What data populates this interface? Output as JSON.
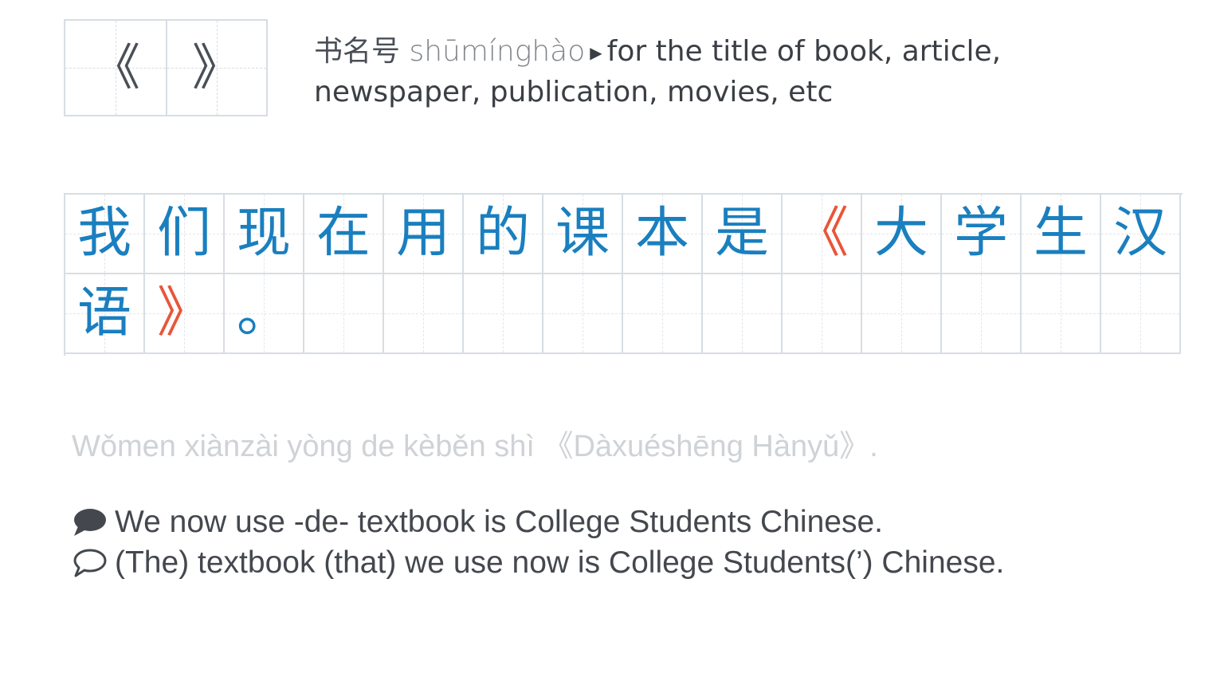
{
  "punctuation": {
    "open_mark": "《",
    "close_mark": "》"
  },
  "description": {
    "hanzi": "书名号",
    "pinyin": "shūmínghào",
    "arrow_icon": "play-triangle-icon",
    "meaning": "for the title of book, article, newspaper, publication, movies, etc"
  },
  "sentence": {
    "characters": [
      "我",
      "们",
      "现",
      "在",
      "用",
      "的",
      "课",
      "本",
      "是",
      "《",
      "大",
      "学",
      "生",
      "汉",
      "语",
      "》",
      "。"
    ],
    "pinyin": "Wǒmen xiànzài yòng de kèběn shì 《Dàxuéshēng Hànyǔ》."
  },
  "translations": {
    "literal": "We now use -de- textbook is College Students Chinese.",
    "natural": "(The) textbook (that) we use now is College Students(’) Chinese.",
    "literal_icon": "filled-speech-bubble-icon",
    "natural_icon": "outline-speech-bubble-icon"
  },
  "colors": {
    "hanzi_blue": "#1a7fbf",
    "title_mark_red": "#e8563a",
    "grid_line": "#d7dde4"
  }
}
